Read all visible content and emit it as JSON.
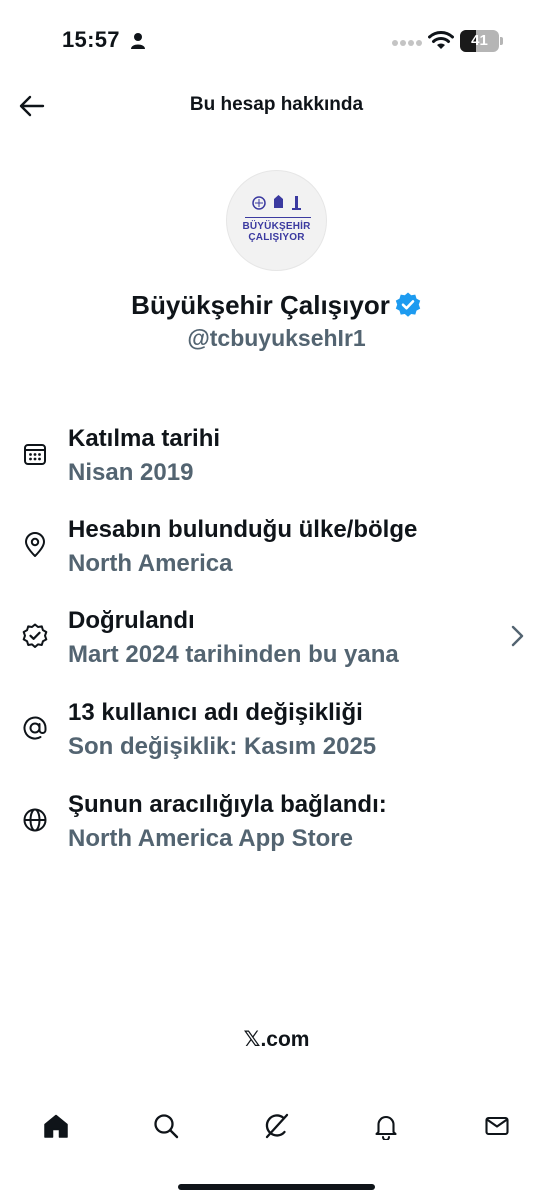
{
  "status_bar": {
    "time": "15:57",
    "battery_level": "41",
    "battery_fraction": 0.41
  },
  "header": {
    "title": "Bu hesap hakkında",
    "back_icon": "arrow-left-icon"
  },
  "profile": {
    "avatar_text_line1": "BÜYÜKŞEHİR",
    "avatar_text_line2": "ÇALIŞIYOR",
    "name": "Büyükşehir Çalışıyor",
    "handle": "@tcbuyuksehIr1",
    "verified_color": "#1d9bf0",
    "avatar_text_color": "#3b3aa0"
  },
  "info_items": [
    {
      "icon": "calendar-icon",
      "title": "Katılma tarihi",
      "value": "Nisan 2019"
    },
    {
      "icon": "location-pin-icon",
      "title": "Hesabın bulunduğu ülke/bölge",
      "value": "North America"
    },
    {
      "icon": "verified-badge-icon",
      "title": "Doğrulandı",
      "value": "Mart 2024 tarihinden bu yana",
      "has_chevron": true
    },
    {
      "icon": "at-sign-icon",
      "title": "13 kullanıcı adı değişikliği",
      "value": "Son değişiklik: Kasım 2025"
    },
    {
      "icon": "globe-icon",
      "title": "Şunun aracılığıyla bağlandı:",
      "value": "North America App Store"
    }
  ],
  "footer": {
    "x_glyph": "𝕏",
    "domain": ".com"
  },
  "tab_bar": {
    "tabs": [
      "home-icon",
      "search-icon",
      "grok-icon",
      "notifications-bell-icon",
      "messages-envelope-icon"
    ],
    "active": "home-icon"
  },
  "colors": {
    "text_primary": "#0f1419",
    "text_secondary": "#536471",
    "background": "#ffffff"
  }
}
